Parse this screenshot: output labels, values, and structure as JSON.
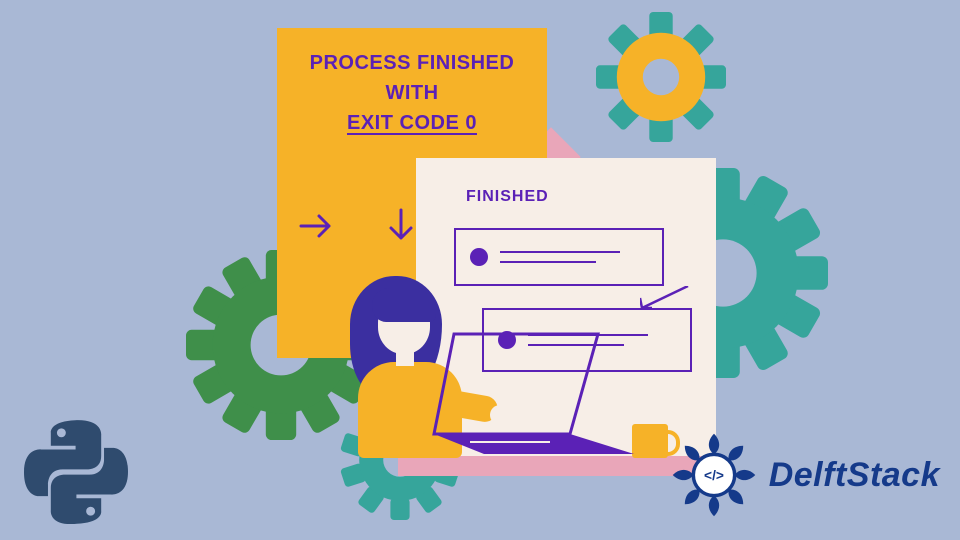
{
  "card": {
    "line1": "PROCESS FINISHED",
    "line2": "WITH",
    "line3": "EXIT CODE 0"
  },
  "panel": {
    "label": "FINISHED"
  },
  "brand": {
    "name": "DelftStack"
  },
  "colors": {
    "bg": "#a9b8d5",
    "orange": "#f6b228",
    "purple": "#5b21b6",
    "cream": "#f7eee7",
    "pink": "#e9a6b9",
    "teal": "#36a59b",
    "green": "#3f8f4a",
    "navy": "#153a8a"
  }
}
